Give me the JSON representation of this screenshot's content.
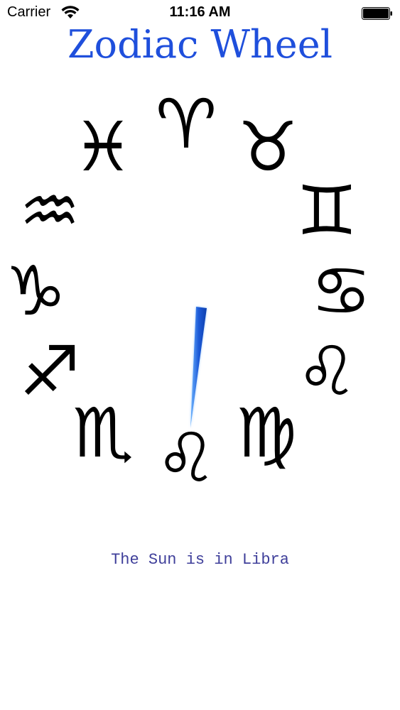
{
  "status_bar": {
    "carrier": "Carrier",
    "time": "11:16 AM",
    "wifi_icon": "wifi-icon",
    "battery_icon": "battery-icon"
  },
  "title": "Zodiac Wheel",
  "colors": {
    "title": "#1f4fdc",
    "caption": "#3f3f9a",
    "hand": "#2a6fe0",
    "glyph": "#000000"
  },
  "wheel": {
    "signs": [
      {
        "name": "aries",
        "glyph": "♈"
      },
      {
        "name": "taurus",
        "glyph": "♉"
      },
      {
        "name": "gemini",
        "glyph": "♊"
      },
      {
        "name": "cancer",
        "glyph": "♋"
      },
      {
        "name": "leo",
        "glyph": "♌"
      },
      {
        "name": "virgo",
        "glyph": "♍"
      },
      {
        "name": "libra",
        "glyph": "♌"
      },
      {
        "name": "scorpio",
        "glyph": "♏"
      },
      {
        "name": "sagittarius",
        "glyph": "♐"
      },
      {
        "name": "capricorn",
        "glyph": "♑"
      },
      {
        "name": "aquarius",
        "glyph": "♒"
      },
      {
        "name": "pisces",
        "glyph": "♓"
      }
    ]
  },
  "caption": "The Sun is in Libra"
}
